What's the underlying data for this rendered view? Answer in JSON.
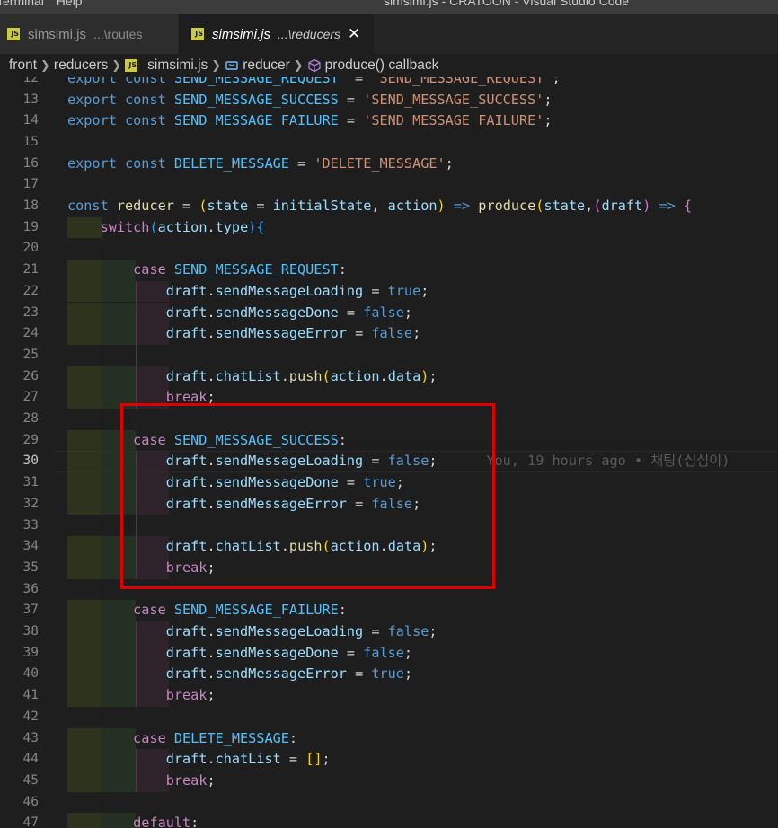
{
  "titlebar": {
    "menu": [
      "Terminal",
      "Help"
    ],
    "window_title": "simsimi.js - CRATOON - Visual Studio Code"
  },
  "tabs": [
    {
      "name": "simsimi.js",
      "desc": "...\\routes",
      "active": false
    },
    {
      "name": "simsimi.js",
      "desc": "...\\reducers",
      "active": true,
      "close": "✕"
    }
  ],
  "breadcrumbs": {
    "items": [
      "front",
      "reducers",
      "simsimi.js",
      "reducer",
      "produce() callback"
    ],
    "separator": "❯"
  },
  "editor": {
    "current_line": 30,
    "blame": "You, 19 hours ago • 채팅(심심이)",
    "highlight_color": "#e00000",
    "lines": [
      {
        "n": 12,
        "tokens": [
          [
            "kw",
            "export "
          ],
          [
            "kw",
            "const "
          ],
          [
            "const",
            "SEND_MESSAGE_REQUEST"
          ],
          [
            "",
            "  = "
          ],
          [
            "str",
            "'SEND_MESSAGE_REQUEST'"
          ],
          [
            "",
            ";"
          ]
        ]
      },
      {
        "n": 13,
        "tokens": [
          [
            "kw",
            "export "
          ],
          [
            "kw",
            "const "
          ],
          [
            "const",
            "SEND_MESSAGE_SUCCESS"
          ],
          [
            "",
            " = "
          ],
          [
            "str",
            "'SEND_MESSAGE_SUCCESS'"
          ],
          [
            "",
            ";"
          ]
        ]
      },
      {
        "n": 14,
        "tokens": [
          [
            "kw",
            "export "
          ],
          [
            "kw",
            "const "
          ],
          [
            "const",
            "SEND_MESSAGE_FAILURE"
          ],
          [
            "",
            " = "
          ],
          [
            "str",
            "'SEND_MESSAGE_FAILURE'"
          ],
          [
            "",
            ";"
          ]
        ]
      },
      {
        "n": 15,
        "tokens": []
      },
      {
        "n": 16,
        "tokens": [
          [
            "kw",
            "export "
          ],
          [
            "kw",
            "const "
          ],
          [
            "const",
            "DELETE_MESSAGE"
          ],
          [
            "",
            " = "
          ],
          [
            "str",
            "'DELETE_MESSAGE'"
          ],
          [
            "",
            ";"
          ]
        ]
      },
      {
        "n": 17,
        "tokens": []
      },
      {
        "n": 18,
        "tokens": [
          [
            "kw",
            "const "
          ],
          [
            "fn",
            "reducer"
          ],
          [
            "",
            " = "
          ],
          [
            "b1",
            "("
          ],
          [
            "var",
            "state"
          ],
          [
            "",
            " = "
          ],
          [
            "var",
            "initialState"
          ],
          [
            "",
            ", "
          ],
          [
            "var",
            "action"
          ],
          [
            "b1",
            ")"
          ],
          [
            "kw",
            " => "
          ],
          [
            "fn",
            "produce"
          ],
          [
            "b1",
            "("
          ],
          [
            "var",
            "state"
          ],
          [
            "",
            ","
          ],
          [
            "b2",
            "("
          ],
          [
            "var",
            "draft"
          ],
          [
            "b2",
            ")"
          ],
          [
            "kw",
            " => "
          ],
          [
            "b2",
            "{"
          ]
        ]
      },
      {
        "n": 19,
        "tokens": [
          [
            "",
            "    "
          ],
          [
            "kwc",
            "switch"
          ],
          [
            "b3",
            "("
          ],
          [
            "var",
            "action"
          ],
          [
            "",
            "."
          ],
          [
            "var",
            "type"
          ],
          [
            "b3",
            ")"
          ],
          [
            "b3",
            "{"
          ]
        ]
      },
      {
        "n": 20,
        "tokens": []
      },
      {
        "n": 21,
        "tokens": [
          [
            "",
            "        "
          ],
          [
            "kwc",
            "case "
          ],
          [
            "const",
            "SEND_MESSAGE_REQUEST"
          ],
          [
            "",
            ":"
          ]
        ]
      },
      {
        "n": 22,
        "tokens": [
          [
            "",
            "            "
          ],
          [
            "var",
            "draft"
          ],
          [
            "",
            "."
          ],
          [
            "var",
            "sendMessageLoading"
          ],
          [
            "",
            " = "
          ],
          [
            "bool",
            "true"
          ],
          [
            "",
            ";"
          ]
        ]
      },
      {
        "n": 23,
        "tokens": [
          [
            "",
            "            "
          ],
          [
            "var",
            "draft"
          ],
          [
            "",
            "."
          ],
          [
            "var",
            "sendMessageDone"
          ],
          [
            "",
            " = "
          ],
          [
            "bool",
            "false"
          ],
          [
            "",
            ";"
          ]
        ]
      },
      {
        "n": 24,
        "tokens": [
          [
            "",
            "            "
          ],
          [
            "var",
            "draft"
          ],
          [
            "",
            "."
          ],
          [
            "var",
            "sendMessageError"
          ],
          [
            "",
            " = "
          ],
          [
            "bool",
            "false"
          ],
          [
            "",
            ";"
          ]
        ]
      },
      {
        "n": 25,
        "tokens": []
      },
      {
        "n": 26,
        "tokens": [
          [
            "",
            "            "
          ],
          [
            "var",
            "draft"
          ],
          [
            "",
            "."
          ],
          [
            "var",
            "chatList"
          ],
          [
            "",
            "."
          ],
          [
            "fn",
            "push"
          ],
          [
            "b1",
            "("
          ],
          [
            "var",
            "action"
          ],
          [
            "",
            "."
          ],
          [
            "var",
            "data"
          ],
          [
            "b1",
            ")"
          ],
          [
            "",
            ";"
          ]
        ]
      },
      {
        "n": 27,
        "tokens": [
          [
            "",
            "            "
          ],
          [
            "kwc",
            "break"
          ],
          [
            "",
            ";"
          ]
        ]
      },
      {
        "n": 28,
        "tokens": []
      },
      {
        "n": 29,
        "tokens": [
          [
            "",
            "        "
          ],
          [
            "kwc",
            "case "
          ],
          [
            "const",
            "SEND_MESSAGE_SUCCESS"
          ],
          [
            "",
            ":"
          ]
        ]
      },
      {
        "n": 30,
        "tokens": [
          [
            "",
            "            "
          ],
          [
            "var",
            "draft"
          ],
          [
            "",
            "."
          ],
          [
            "var",
            "sendMessageLoading"
          ],
          [
            "",
            " = "
          ],
          [
            "bool",
            "false"
          ],
          [
            "",
            ";"
          ]
        ]
      },
      {
        "n": 31,
        "tokens": [
          [
            "",
            "            "
          ],
          [
            "var",
            "draft"
          ],
          [
            "",
            "."
          ],
          [
            "var",
            "sendMessageDone"
          ],
          [
            "",
            " = "
          ],
          [
            "bool",
            "true"
          ],
          [
            "",
            ";"
          ]
        ]
      },
      {
        "n": 32,
        "tokens": [
          [
            "",
            "            "
          ],
          [
            "var",
            "draft"
          ],
          [
            "",
            "."
          ],
          [
            "var",
            "sendMessageError"
          ],
          [
            "",
            " = "
          ],
          [
            "bool",
            "false"
          ],
          [
            "",
            ";"
          ]
        ]
      },
      {
        "n": 33,
        "tokens": []
      },
      {
        "n": 34,
        "tokens": [
          [
            "",
            "            "
          ],
          [
            "var",
            "draft"
          ],
          [
            "",
            "."
          ],
          [
            "var",
            "chatList"
          ],
          [
            "",
            "."
          ],
          [
            "fn",
            "push"
          ],
          [
            "b1",
            "("
          ],
          [
            "var",
            "action"
          ],
          [
            "",
            "."
          ],
          [
            "var",
            "data"
          ],
          [
            "b1",
            ")"
          ],
          [
            "",
            ";"
          ]
        ]
      },
      {
        "n": 35,
        "tokens": [
          [
            "",
            "            "
          ],
          [
            "kwc",
            "break"
          ],
          [
            "",
            ";"
          ]
        ]
      },
      {
        "n": 36,
        "tokens": []
      },
      {
        "n": 37,
        "tokens": [
          [
            "",
            "        "
          ],
          [
            "kwc",
            "case "
          ],
          [
            "const",
            "SEND_MESSAGE_FAILURE"
          ],
          [
            "",
            ":"
          ]
        ]
      },
      {
        "n": 38,
        "tokens": [
          [
            "",
            "            "
          ],
          [
            "var",
            "draft"
          ],
          [
            "",
            "."
          ],
          [
            "var",
            "sendMessageLoading"
          ],
          [
            "",
            " = "
          ],
          [
            "bool",
            "false"
          ],
          [
            "",
            ";"
          ]
        ]
      },
      {
        "n": 39,
        "tokens": [
          [
            "",
            "            "
          ],
          [
            "var",
            "draft"
          ],
          [
            "",
            "."
          ],
          [
            "var",
            "sendMessageDone"
          ],
          [
            "",
            " = "
          ],
          [
            "bool",
            "false"
          ],
          [
            "",
            ";"
          ]
        ]
      },
      {
        "n": 40,
        "tokens": [
          [
            "",
            "            "
          ],
          [
            "var",
            "draft"
          ],
          [
            "",
            "."
          ],
          [
            "var",
            "sendMessageError"
          ],
          [
            "",
            " = "
          ],
          [
            "bool",
            "true"
          ],
          [
            "",
            ";"
          ]
        ]
      },
      {
        "n": 41,
        "tokens": [
          [
            "",
            "            "
          ],
          [
            "kwc",
            "break"
          ],
          [
            "",
            ";"
          ]
        ]
      },
      {
        "n": 42,
        "tokens": []
      },
      {
        "n": 43,
        "tokens": [
          [
            "",
            "        "
          ],
          [
            "kwc",
            "case "
          ],
          [
            "const",
            "DELETE_MESSAGE"
          ],
          [
            "",
            ":"
          ]
        ]
      },
      {
        "n": 44,
        "tokens": [
          [
            "",
            "            "
          ],
          [
            "var",
            "draft"
          ],
          [
            "",
            "."
          ],
          [
            "var",
            "chatList"
          ],
          [
            "",
            " = "
          ],
          [
            "b1",
            "[]"
          ],
          [
            "",
            ";"
          ]
        ]
      },
      {
        "n": 45,
        "tokens": [
          [
            "",
            "            "
          ],
          [
            "kwc",
            "break"
          ],
          [
            "",
            ";"
          ]
        ]
      },
      {
        "n": 46,
        "tokens": []
      },
      {
        "n": 47,
        "tokens": [
          [
            "",
            "        "
          ],
          [
            "kwc",
            "default"
          ],
          [
            "",
            ":"
          ]
        ]
      }
    ]
  }
}
